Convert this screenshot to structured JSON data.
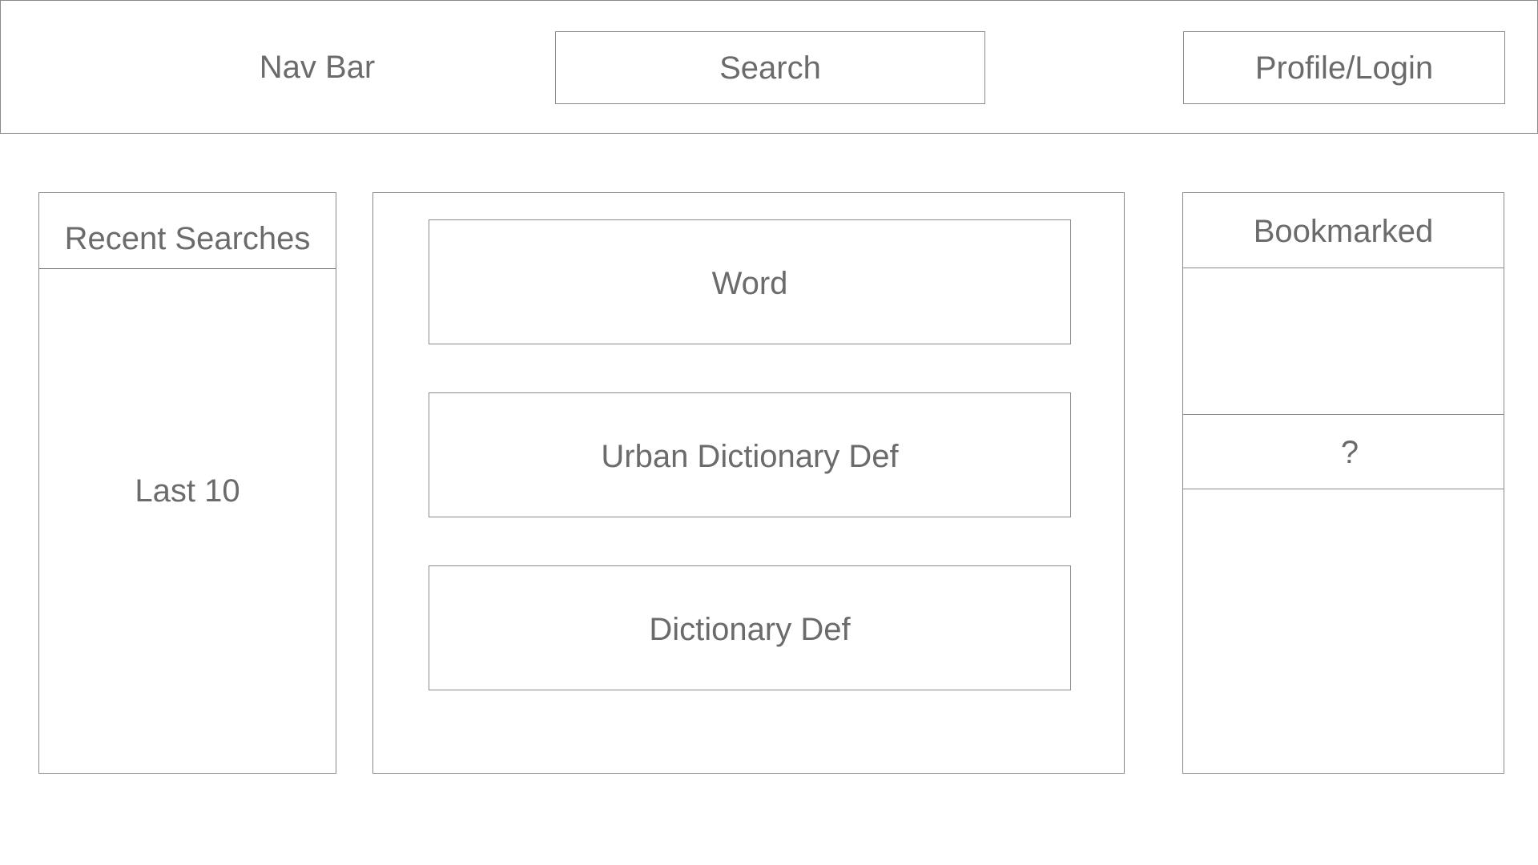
{
  "navbar": {
    "title": "Nav Bar",
    "search_label": "Search",
    "profile_label": "Profile/Login"
  },
  "recent_searches": {
    "header": "Recent Searches",
    "body": "Last 10"
  },
  "main": {
    "word_label": "Word",
    "urban_def_label": "Urban Dictionary Def",
    "dictionary_def_label": "Dictionary Def"
  },
  "bookmarked": {
    "header": "Bookmarked",
    "slot_2_label": "?"
  },
  "colors": {
    "border": "#8a8a8a",
    "text": "#6b6b6b",
    "background": "#ffffff"
  }
}
